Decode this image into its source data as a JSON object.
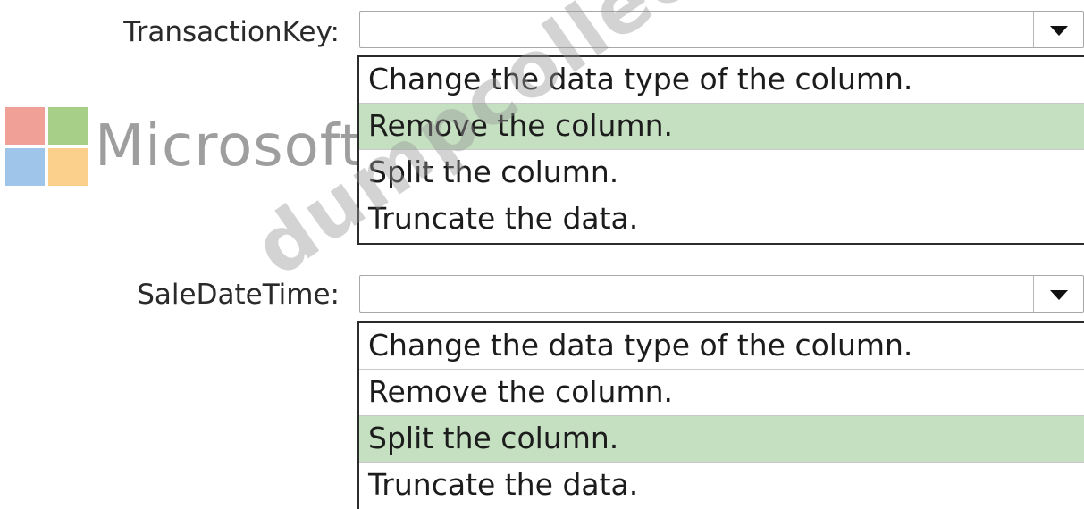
{
  "watermark": {
    "brand": "Microsoft",
    "site": "dumpcollection.com"
  },
  "fields": [
    {
      "label": "TransactionKey:",
      "value": "",
      "options": [
        "Change the data type of the column.",
        "Remove the column.",
        "Split the column.",
        "Truncate the data."
      ],
      "selected_index": 1
    },
    {
      "label": "SaleDateTime:",
      "value": "",
      "options": [
        "Change the data type of the column.",
        "Remove the column.",
        "Split the column.",
        "Truncate the data."
      ],
      "selected_index": 2
    }
  ],
  "colors": {
    "selected_highlight": "#c5e0c1",
    "list_border": "#2b2b2b"
  },
  "icons": {
    "dropdown": "chevron-down-icon",
    "logo": "microsoft-logo-icon"
  }
}
